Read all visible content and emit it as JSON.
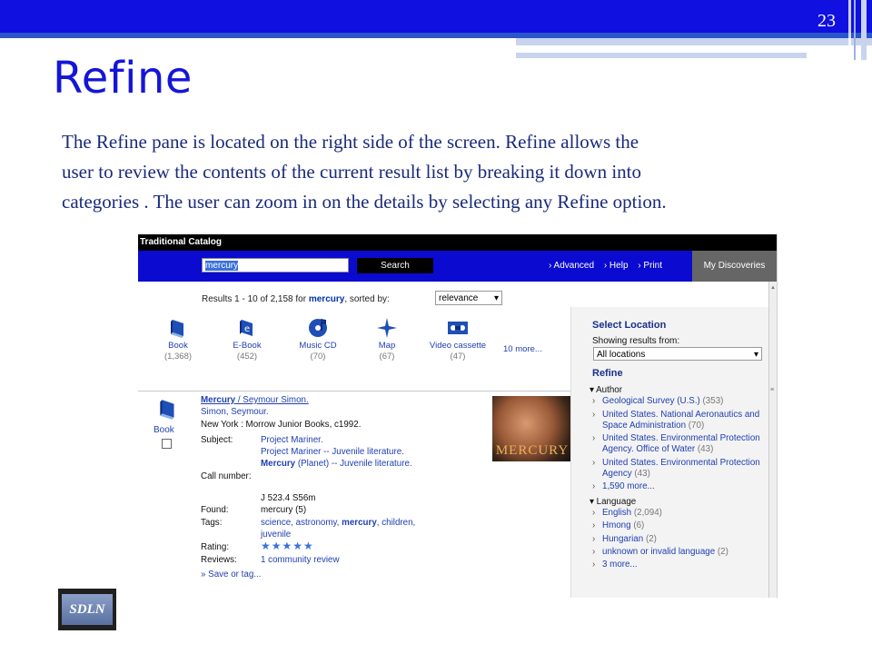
{
  "slide": {
    "number": "23",
    "title": "Refine",
    "body_lines": [
      "The Refine pane is located on the right side of the screen. Refine allows the",
      "user to review the contents of the current result list by breaking it down into",
      "categories . The user can zoom in on the details by selecting any Refine option."
    ],
    "logo_text": "SDLN"
  },
  "catalog": {
    "window_title": "Traditional Catalog",
    "search_value": "mercury",
    "search_button": "Search",
    "links": [
      "› Advanced",
      "› Help",
      "› Print"
    ],
    "my_discoveries": "My Discoveries",
    "results_prefix": "Results 1 - 10 of 2,158 for ",
    "results_query": "mercury",
    "results_suffix": ", sorted by:",
    "sort_value": "relevance",
    "formats": [
      {
        "label": "Book",
        "count": "(1,368)",
        "icon": "book-icon"
      },
      {
        "label": "E-Book",
        "count": "(452)",
        "icon": "ebook-icon"
      },
      {
        "label": "Music CD",
        "count": "(70)",
        "icon": "music-cd-icon"
      },
      {
        "label": "Map",
        "count": "(67)",
        "icon": "map-icon"
      },
      {
        "label": "Video cassette",
        "count": "(47)",
        "icon": "video-cassette-icon"
      }
    ],
    "more_formats": "10 more...",
    "record": {
      "type_label": "Book",
      "title_link": "Mercury",
      "author_inline": " / Seymour Simon.",
      "author": "Simon, Seymour.",
      "publisher": "New York : Morrow Junior Books, c1992.",
      "subject_label": "Subject:",
      "subjects": [
        "Project Mariner.",
        "Project Mariner -- Juvenile literature."
      ],
      "subject3_bold": "Mercury",
      "subject3_rest": " (Planet) -- Juvenile literature.",
      "call_label": "Call number:",
      "call_number": "J 523.4 S56m",
      "found_label": "Found:",
      "found_value": "mercury (5)",
      "tags_label": "Tags:",
      "tags_part1": "science, astronomy, ",
      "tags_bold": "mercury",
      "tags_part2": ", children,",
      "tags_line2": "juvenile",
      "rating_label": "Rating:",
      "rating_stars": "★★★★★",
      "reviews_label": "Reviews:",
      "reviews_value": "1 community review",
      "save_tag": "» Save or tag...",
      "cover_text": "MERCURY"
    },
    "refine_pane": {
      "select_location_title": "Select Location",
      "showing_label": "Showing results from:",
      "location_value": "All locations",
      "refine_title": "Refine",
      "author_header": "Author",
      "authors": [
        {
          "name": "Geological Survey (U.S.)",
          "count": "(353)"
        },
        {
          "name": "United States. National Aeronautics and Space Administration",
          "count": "(70)"
        },
        {
          "name": "United States. Environmental Protection Agency. Office of Water",
          "count": "(43)"
        },
        {
          "name": "United States. Environmental Protection Agency",
          "count": "(43)"
        }
      ],
      "author_more": "1,590 more...",
      "language_header": "Language",
      "languages": [
        {
          "name": "English",
          "count": "(2,094)"
        },
        {
          "name": "Hmong",
          "count": "(6)"
        },
        {
          "name": "Hungarian",
          "count": "(2)"
        },
        {
          "name": "unknown or invalid language",
          "count": "(2)"
        }
      ],
      "language_more": "3 more..."
    }
  },
  "colors": {
    "header_blue": "#1010e0",
    "title_blue": "#1515d8",
    "body_text": "#1a2a7a",
    "link_blue": "#2040b0"
  }
}
